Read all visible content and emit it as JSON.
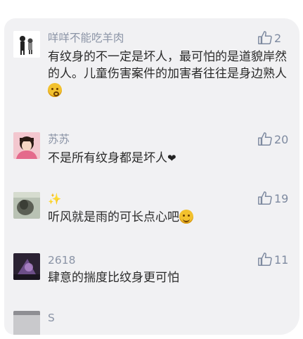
{
  "comments": [
    {
      "user": "咩咩不能吃羊肉",
      "likes": "2",
      "text": "有纹身的不一定是坏人，最可怕的是道貌岸然的人。儿童伤害案件的加害者往往是身边熟人",
      "emoji": "smiling-face-icon"
    },
    {
      "user": "苏苏",
      "likes": "20",
      "text": "不是所有纹身都是坏人",
      "emoji": "heart-icon"
    },
    {
      "user": "✨",
      "likes": "19",
      "text": "听风就是雨的可长点心吧",
      "emoji": "smiling-face-icon"
    },
    {
      "user": "2618",
      "likes": "11",
      "text": "肆意的揣度比纹身更可怕",
      "emoji": ""
    },
    {
      "user": "S",
      "likes": "",
      "text": "",
      "emoji": ""
    }
  ],
  "colors": {
    "background": "#f1f1f3",
    "username": "#8b94a6",
    "like_icon": "#7e8aa0",
    "text": "#2a2a2a"
  }
}
